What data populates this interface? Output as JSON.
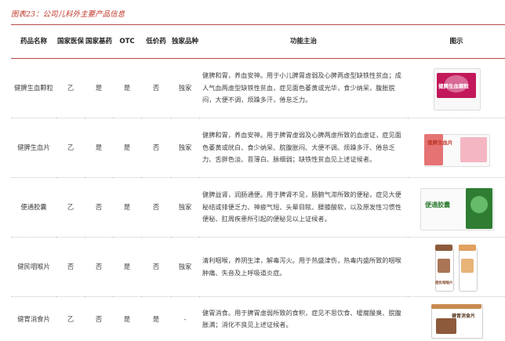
{
  "caption": "图表23：公司儿科外主要产品信息",
  "headers": {
    "name": "药品名称",
    "insurance": "国家医保",
    "essential": "国家基药",
    "otc": "OTC",
    "lowprice": "低价药",
    "exclusive": "独家品种",
    "function": "功能主治",
    "image": "图示"
  },
  "rows": [
    {
      "name": "健脾生血颗粒",
      "insurance": "乙",
      "essential": "是",
      "otc": "是",
      "lowprice": "否",
      "exclusive": "独家",
      "function": "健脾和胃，养血安神。用于小儿脾胃虚弱及心脾两虚型缺铁性贫血；成人气血两虚型缺铁性贫血，症见面色萎黄或光华，食少纳呆，腹胀脘闷，大便不调，烦躁多汗，倦怠乏力。",
      "pack_label": "健脾生血颗粒"
    },
    {
      "name": "健脾生血片",
      "insurance": "乙",
      "essential": "是",
      "otc": "是",
      "lowprice": "否",
      "exclusive": "独家",
      "function": "健脾和胃，养血安神。用于脾胃虚弱及心脾两虚所致的血虚证，症见面色萎黄或㿠白、食少纳呆、脘腹胀闷、大便不调、烦躁多汗、倦怠乏力、舌胖色淡、苔薄白、脉细弱；缺铁性贫血见上述证候者。",
      "pack_label": "健脾生血片"
    },
    {
      "name": "便通胶囊",
      "insurance": "乙",
      "essential": "否",
      "otc": "是",
      "lowprice": "否",
      "exclusive": "独家",
      "function": "健脾益肾，润肠通便。用于脾肾不足，肠腑气滞所致的便秘，症见大便秘结或排便乏力、神疲气短、头晕目眩、腰膝酸软，以及原发性习惯性便秘、肛周疾患所引起的便秘见以上证候者。",
      "pack_label": "便通胶囊"
    },
    {
      "name": "健民咽喉片",
      "insurance": "否",
      "essential": "否",
      "otc": "是",
      "lowprice": "否",
      "exclusive": "独家",
      "function": "清利咽喉，养阴生津，解毒泻火。用于热盛津伤，热毒内盛所致的咽喉肿痛、失音及上呼吸道炎症。",
      "pack_label": "健民咽喉片"
    },
    {
      "name": "健胃消食片",
      "insurance": "乙",
      "essential": "否",
      "otc": "是",
      "lowprice": "是",
      "exclusive": "-",
      "function": "健胃消食。用于脾胃虚弱所致的食积，症见不思饮食、嗳腐酸臭、脘腹胀满；消化不良见上述证候者。",
      "pack_label": "健胃消食片"
    }
  ],
  "colors": {
    "caption": "#c0392b",
    "rule": "#b54a4a",
    "pack1": "#c2185b",
    "pack2": "#e57373",
    "pack3": "#2e7d32",
    "pack4": "#e0a060",
    "pack5": "#8d5a3b"
  }
}
